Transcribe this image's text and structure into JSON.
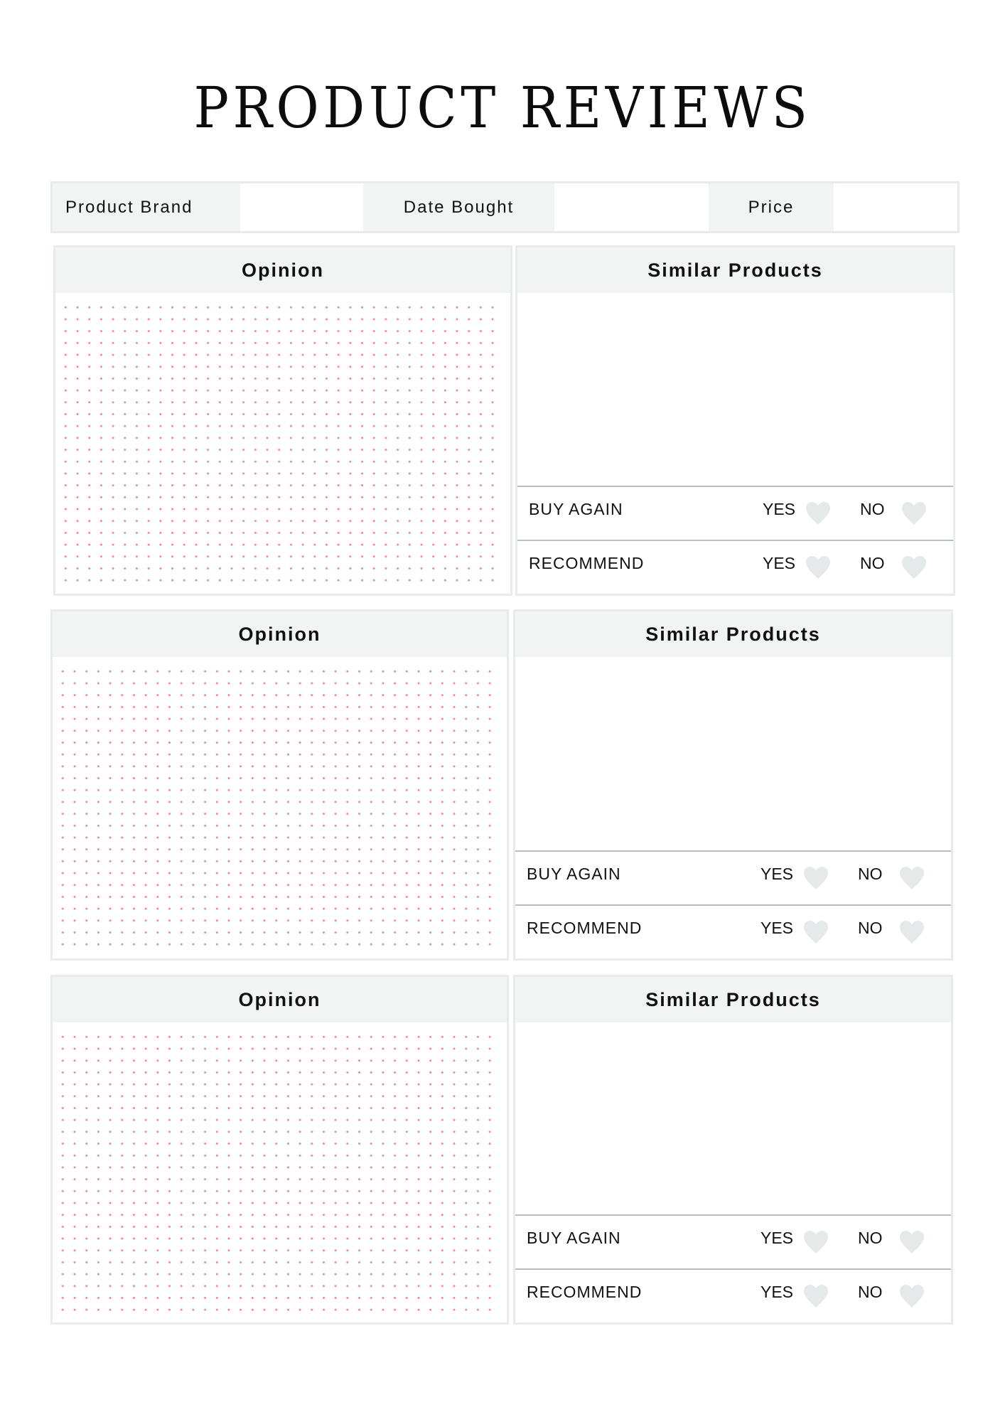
{
  "title": "PRODUCT REVIEWS",
  "info_bar": {
    "product_brand_label": "Product Brand",
    "product_brand_value": "",
    "date_bought_label": "Date Bought",
    "date_bought_value": "",
    "price_label": "Price",
    "price_value": ""
  },
  "colors": {
    "header_fill": "#f2f3f3",
    "border": "#e8ebeb",
    "dot_grid": "#f07ac4",
    "heart": "#e6e9ea",
    "divider": "#b9bdc0"
  },
  "reviews": [
    {
      "opinion_title": "Opinion",
      "opinion_text": "",
      "similar_title": "Similar Products",
      "similar_text": "",
      "buy_again_label": "BUY AGAIN",
      "recommend_label": "RECOMMEND",
      "yes_label": "YES",
      "no_label": "NO",
      "heart_icon": "heart-icon"
    },
    {
      "opinion_title": "Opinion",
      "opinion_text": "",
      "similar_title": "Similar Products",
      "similar_text": "",
      "buy_again_label": "BUY AGAIN",
      "recommend_label": "RECOMMEND",
      "yes_label": "YES",
      "no_label": "NO",
      "heart_icon": "heart-icon"
    },
    {
      "opinion_title": "Opinion",
      "opinion_text": "",
      "similar_title": "Similar Products",
      "similar_text": "",
      "buy_again_label": "BUY AGAIN",
      "recommend_label": "RECOMMEND",
      "yes_label": "YES",
      "no_label": "NO",
      "heart_icon": "heart-icon"
    }
  ]
}
